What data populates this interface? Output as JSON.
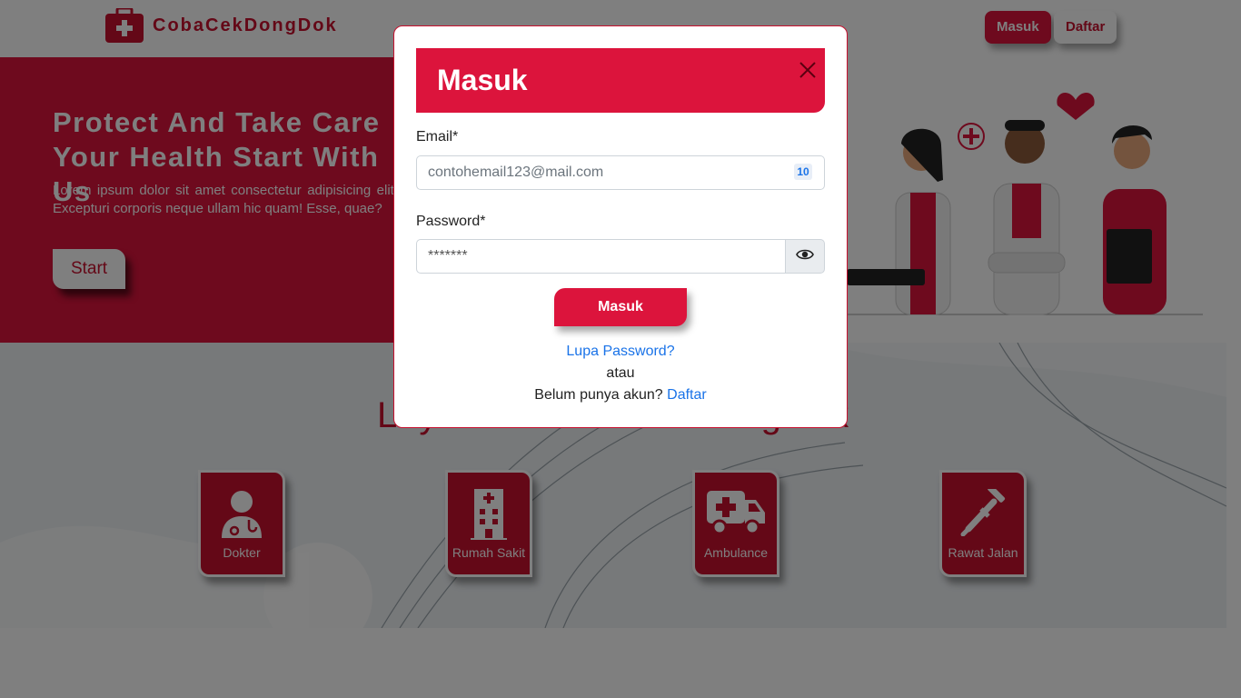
{
  "brand": {
    "name": "CobaCekDongDok"
  },
  "nav": {
    "login_label": "Masuk",
    "register_label": "Daftar"
  },
  "hero": {
    "title": "Protect And Take Care Your Health Start With Us",
    "text": "Lorem ipsum dolor sit amet consectetur adipisicing elit. Excepturi corporis neque ullam hic quam! Esse, quae?",
    "start_label": "Start"
  },
  "services": {
    "title": "Layanan CobaCekDongDok",
    "items": [
      {
        "label": "Dokter",
        "icon": "doctor-icon"
      },
      {
        "label": "Rumah Sakit",
        "icon": "hospital-icon"
      },
      {
        "label": "Ambulance",
        "icon": "ambulance-icon"
      },
      {
        "label": "Rawat Jalan",
        "icon": "crutch-icon"
      }
    ]
  },
  "modal": {
    "title": "Masuk",
    "email_label": "Email*",
    "email_placeholder": "contohemail123@mail.com",
    "password_label": "Password*",
    "password_value": "*******",
    "submit_label": "Masuk",
    "forgot_label": "Lupa Password?",
    "or_label": "atau",
    "no_account_label": "Belum punya akun?",
    "register_link": "Daftar"
  },
  "colors": {
    "primary": "#dc143c",
    "link": "#1a73e8",
    "overlay": "rgba(0,0,0,0.5)"
  }
}
